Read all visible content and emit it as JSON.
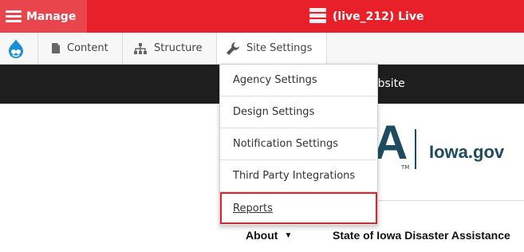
{
  "admin_bar": {
    "manage_label": "Manage",
    "environment_label": "(live_212) Live",
    "color": "#e8202a"
  },
  "toolbar": {
    "items": [
      {
        "label": "Content",
        "icon": "document-icon"
      },
      {
        "label": "Structure",
        "icon": "sitemap-icon"
      },
      {
        "label": "Site Settings",
        "icon": "wrench-icon"
      }
    ]
  },
  "site_settings_menu": {
    "items": [
      {
        "label": "Agency Settings"
      },
      {
        "label": "Design Settings"
      },
      {
        "label": "Notification Settings"
      },
      {
        "label": "Third Party Integrations"
      },
      {
        "label": "Reports",
        "highlighted": true
      }
    ]
  },
  "page": {
    "band_text": "ebsite",
    "logo_letter": "A",
    "logo_tm": "TM",
    "logo_text": "Iowa.gov",
    "nav": {
      "about": "About",
      "disaster": "State of Iowa Disaster Assistance"
    }
  }
}
